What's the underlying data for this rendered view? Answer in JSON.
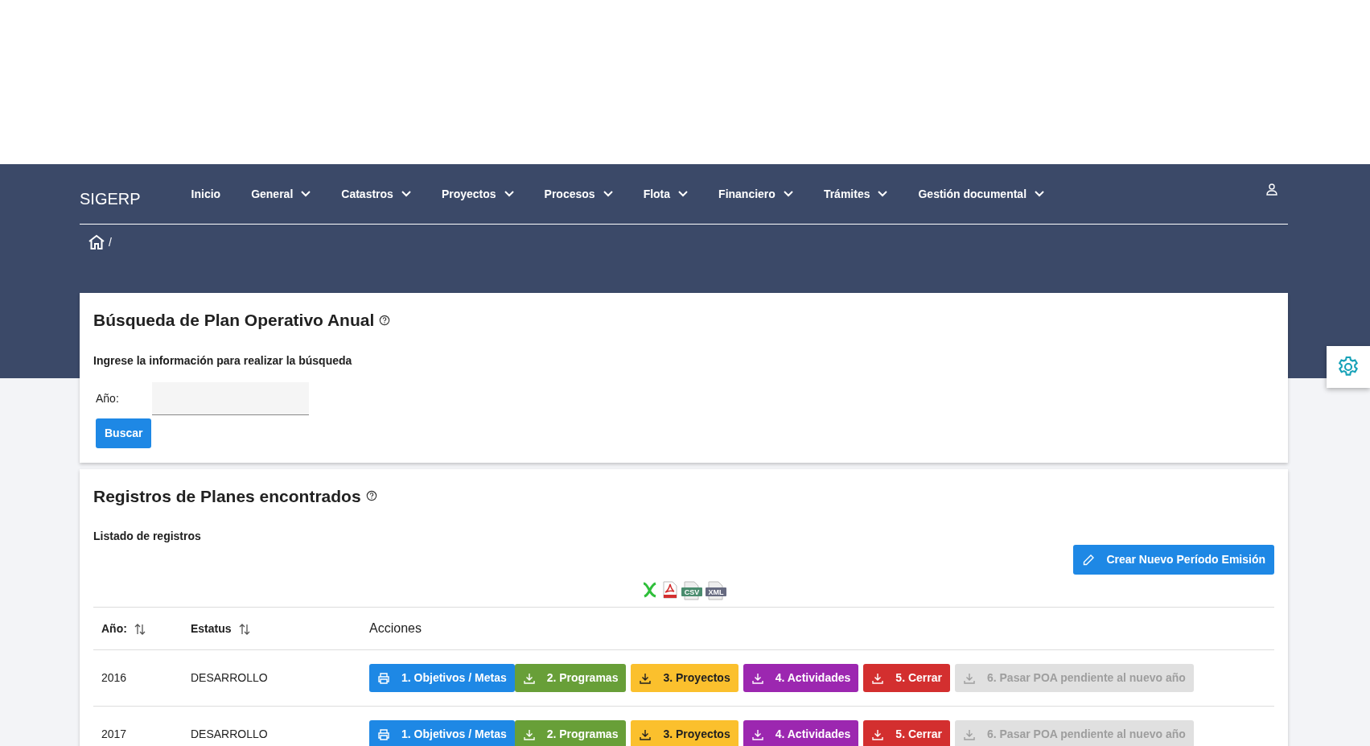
{
  "navbar": {
    "brand": "SIGERP",
    "items": [
      {
        "label": "Inicio",
        "dropdown": false
      },
      {
        "label": "General",
        "dropdown": true
      },
      {
        "label": "Catastros",
        "dropdown": true
      },
      {
        "label": "Proyectos",
        "dropdown": true
      },
      {
        "label": "Procesos",
        "dropdown": true
      },
      {
        "label": "Flota",
        "dropdown": true
      },
      {
        "label": "Financiero",
        "dropdown": true
      },
      {
        "label": "Trámites",
        "dropdown": true
      },
      {
        "label": "Gestión documental",
        "dropdown": true
      }
    ]
  },
  "breadcrumb": {
    "separator": "/"
  },
  "search_card": {
    "title": "Búsqueda de Plan Operativo Anual",
    "subtitle": "Ingrese la información para realizar la búsqueda",
    "field_label": "Año:",
    "button": "Buscar"
  },
  "results_card": {
    "title": "Registros de Planes encontrados",
    "subtitle": "Listado de registros",
    "create_button": "Crear Nuevo Período Emisión",
    "export_icons": [
      {
        "kind": "excel"
      },
      {
        "kind": "pdf"
      },
      {
        "kind": "csv",
        "label": "CSV"
      },
      {
        "kind": "xml",
        "label": "XML"
      }
    ],
    "table": {
      "columns": [
        {
          "label": "Año:",
          "sortable": true
        },
        {
          "label": "Estatus",
          "sortable": true
        },
        {
          "label": "Acciones",
          "sortable": false
        }
      ],
      "rows": [
        {
          "year": "2016",
          "status": "DESARROLLO",
          "actions": [
            {
              "label": "1. Objetivos / Metas",
              "kind": "print",
              "color": "#1e88e5",
              "disabled": false
            },
            {
              "label": "2. Programas",
              "kind": "download",
              "color": "#689f38",
              "disabled": false
            },
            {
              "label": "3. Proyectos",
              "kind": "download",
              "color": "#fbc02d",
              "disabled": false
            },
            {
              "label": "4. Actividades",
              "kind": "download",
              "color": "#9c27b0",
              "disabled": false
            },
            {
              "label": "5. Cerrar",
              "kind": "download",
              "color": "#d32f2f",
              "disabled": false
            },
            {
              "label": "6. Pasar POA pendiente al nuevo año",
              "kind": "download",
              "color": "#e0e0e0",
              "disabled": true
            }
          ]
        },
        {
          "year": "2017",
          "status": "DESARROLLO",
          "actions": [
            {
              "label": "1. Objetivos / Metas",
              "kind": "print",
              "color": "#1e88e5",
              "disabled": false
            },
            {
              "label": "2. Programas",
              "kind": "download",
              "color": "#689f38",
              "disabled": false
            },
            {
              "label": "3. Proyectos",
              "kind": "download",
              "color": "#fbc02d",
              "disabled": false
            },
            {
              "label": "4. Actividades",
              "kind": "download",
              "color": "#9c27b0",
              "disabled": false
            },
            {
              "label": "5. Cerrar",
              "kind": "download",
              "color": "#d32f2f",
              "disabled": false
            },
            {
              "label": "6. Pasar POA pendiente al nuevo año",
              "kind": "download",
              "color": "#e0e0e0",
              "disabled": true
            }
          ]
        }
      ]
    }
  }
}
